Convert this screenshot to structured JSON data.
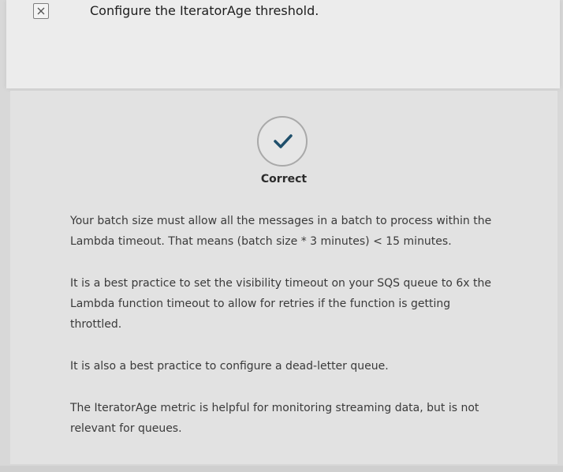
{
  "option": {
    "text": "Configure the IteratorAge threshold."
  },
  "feedback": {
    "status": "Correct",
    "paragraphs": [
      "Your batch size must allow all the messages in a batch to process within the Lambda timeout. That means (batch size * 3 minutes) < 15 minutes.",
      "It is a best practice to set the visibility timeout on your SQS queue to 6x the Lambda function timeout to allow for retries if the function is getting throttled.",
      "It is also a best practice to configure a dead-letter queue.",
      "The IteratorAge metric is helpful for monitoring streaming data, but is not relevant for queues."
    ]
  },
  "colors": {
    "check": "#1f4f6b"
  },
  "icons": {
    "option_marker": "close-x-icon",
    "status": "checkmark-icon"
  }
}
